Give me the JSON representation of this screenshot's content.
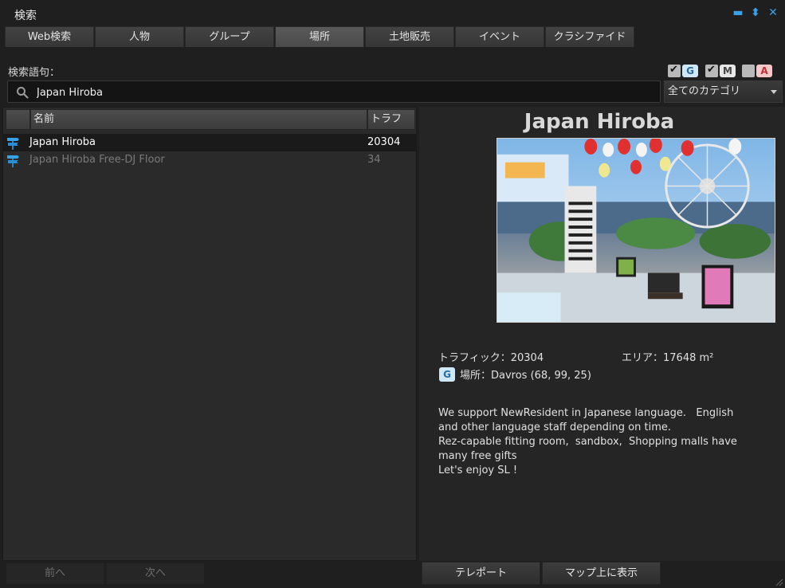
{
  "window": {
    "title": "検索",
    "minimize": "▬",
    "pin": "⬍",
    "close": "✕"
  },
  "tabs": [
    {
      "label": "Web検索"
    },
    {
      "label": "人物"
    },
    {
      "label": "グループ"
    },
    {
      "label": "場所",
      "active": true
    },
    {
      "label": "土地販売"
    },
    {
      "label": "イベント"
    },
    {
      "label": "クラシファイド"
    }
  ],
  "search": {
    "label": "検索語句：",
    "value": "Japan Hiroba"
  },
  "maturity": [
    {
      "badge": "G",
      "checked": true
    },
    {
      "badge": "M",
      "checked": true
    },
    {
      "badge": "A",
      "checked": false
    }
  ],
  "category": {
    "selected": "全てのカテゴリ"
  },
  "results": {
    "columns": {
      "icon": "",
      "name": "名前",
      "traffic": "トラフ"
    },
    "rows": [
      {
        "name": "Japan Hiroba",
        "traffic": "20304",
        "selected": true
      },
      {
        "name": "Japan Hiroba Free-DJ Floor",
        "traffic": "34",
        "selected": false
      }
    ]
  },
  "pagination": {
    "prev": "前へ",
    "next": "次へ"
  },
  "detail": {
    "title": "Japan Hiroba",
    "traffic": "トラフィック：20304",
    "area": "エリア：17648 m²",
    "rating_badge": "G",
    "location": "場所：Davros (68, 99, 25)",
    "description": [
      "We support NewResident in Japanese language.   English",
      "and other language staff depending on time.",
      "Rez-capable fitting room,  sandbox,  Shopping malls have",
      "many free gifts",
      "Let's enjoy SL !"
    ],
    "teleport": "テレポート",
    "show_on_map": "マップ上に表示"
  },
  "colors": {
    "accent": "#3aa0e8",
    "background": "#1f1f1f",
    "panel": "#2a2a2a"
  },
  "icons": [
    "search-icon",
    "landmark-icon",
    "minimize-icon",
    "pin-icon",
    "close-icon",
    "resize-icon"
  ]
}
